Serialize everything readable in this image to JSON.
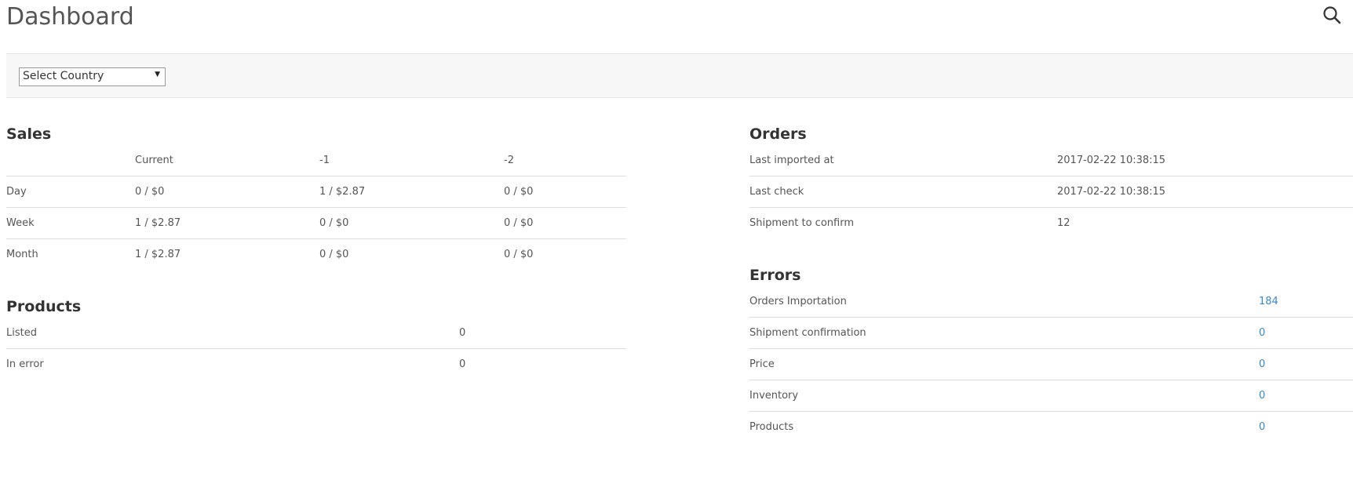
{
  "header": {
    "title": "Dashboard",
    "search_icon": "search-icon"
  },
  "filter": {
    "country_select_value": "Select Country"
  },
  "sales": {
    "title": "Sales",
    "columns": [
      "",
      "Current",
      "-1",
      "-2"
    ],
    "rows": [
      {
        "label": "Day",
        "values": [
          "0 / $0",
          "1 / $2.87",
          "0 / $0"
        ]
      },
      {
        "label": "Week",
        "values": [
          "1 / $2.87",
          "0 / $0",
          "0 / $0"
        ]
      },
      {
        "label": "Month",
        "values": [
          "1 / $2.87",
          "0 / $0",
          "0 / $0"
        ]
      }
    ]
  },
  "products": {
    "title": "Products",
    "rows": [
      {
        "label": "Listed",
        "value": "0"
      },
      {
        "label": "In error",
        "value": "0"
      }
    ]
  },
  "orders": {
    "title": "Orders",
    "rows": [
      {
        "label": "Last imported at",
        "value": "2017-02-22 10:38:15"
      },
      {
        "label": "Last check",
        "value": "2017-02-22 10:38:15"
      },
      {
        "label": "Shipment to confirm",
        "value": "12"
      }
    ]
  },
  "errors": {
    "title": "Errors",
    "link_color": "#3a87c8",
    "rows": [
      {
        "label": "Orders Importation",
        "value": "184"
      },
      {
        "label": "Shipment confirmation",
        "value": "0"
      },
      {
        "label": "Price",
        "value": "0"
      },
      {
        "label": "Inventory",
        "value": "0"
      },
      {
        "label": "Products",
        "value": "0"
      }
    ]
  }
}
